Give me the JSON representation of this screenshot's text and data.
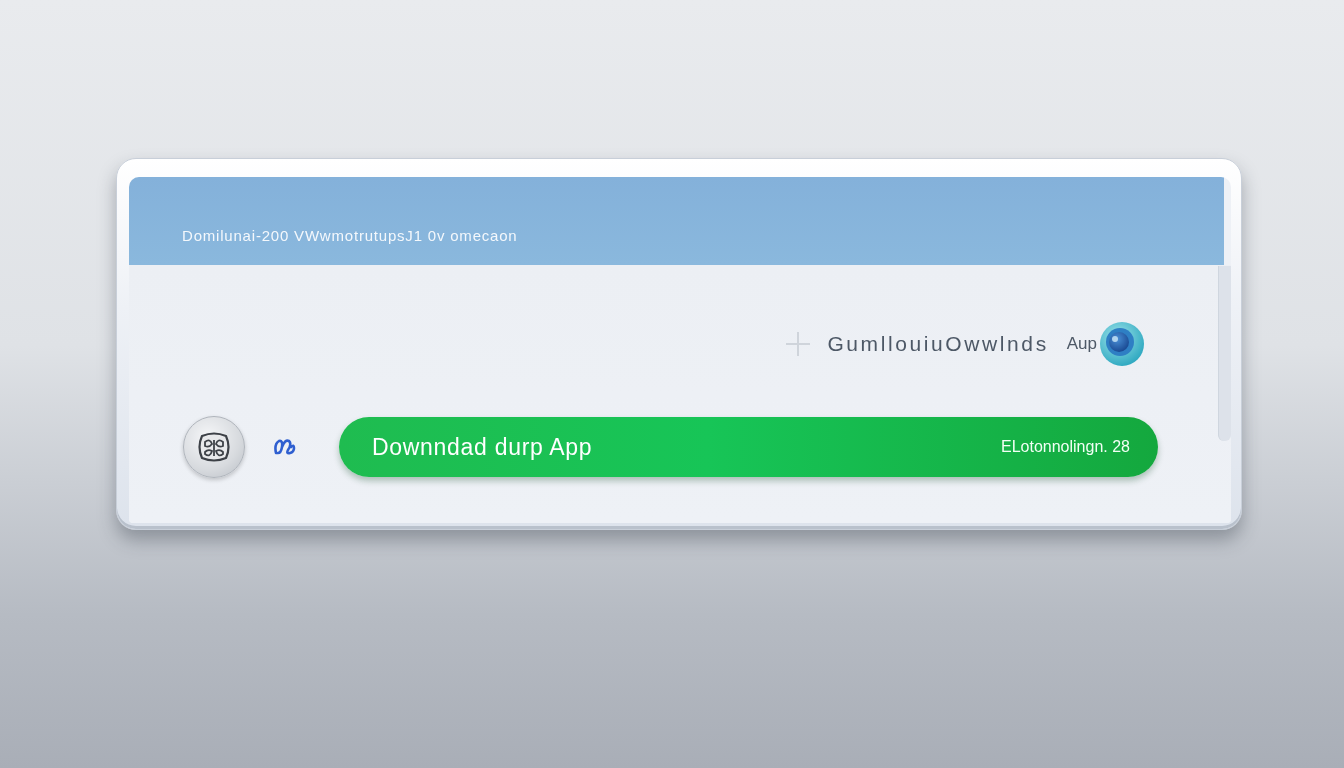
{
  "header": {
    "title": "Domilunai-200 VWwmotrutupsJ1 0v omecaon"
  },
  "download_row": {
    "label": "GumllouiuOwwlnds",
    "suffix": "Aup"
  },
  "action_bar": {
    "button": {
      "label": "Downndad durp App",
      "detail": "ELotonnolingn. 28"
    }
  }
}
